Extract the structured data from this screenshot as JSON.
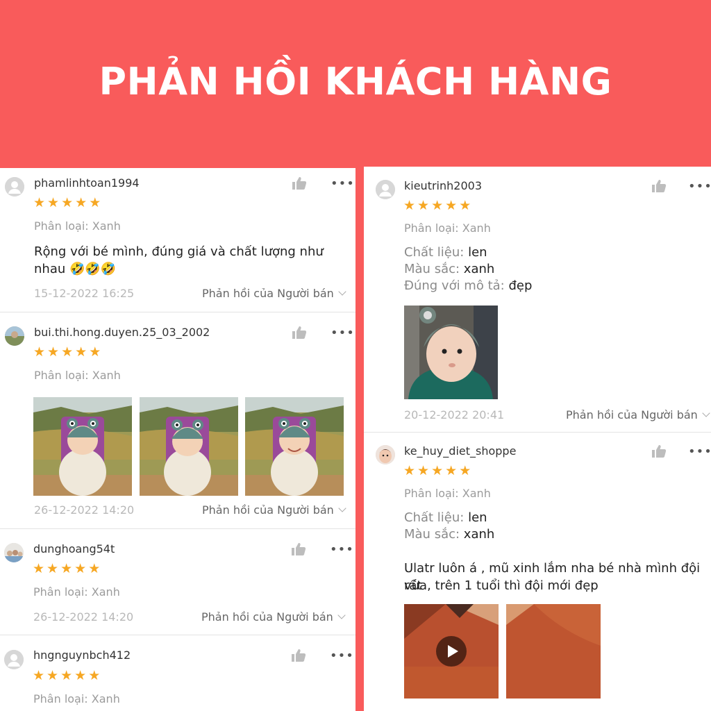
{
  "banner": {
    "title": "PHẢN HỒI KHÁCH HÀNG"
  },
  "reviews_left": [
    {
      "username": "phamlinhtoan1994",
      "rating": 5,
      "variant": "Phân loại: Xanh",
      "text_line1": "Rộng với bé mình, đúng giá và chất lượng như",
      "text_line2": "nhau 🤣🤣🤣",
      "date": "15-12-2022 16:25",
      "seller_reply": "Phản hồi của Người bán"
    },
    {
      "username": "bui.thi.hong.duyen.25_03_2002",
      "rating": 5,
      "variant": "Phân loại: Xanh",
      "date": "26-12-2022 14:20",
      "seller_reply": "Phản hồi của Người bán"
    },
    {
      "username": "dunghoang54t",
      "rating": 5,
      "variant": "Phân loại: Xanh",
      "date": "26-12-2022 14:20",
      "seller_reply": "Phản hồi của Người bán"
    },
    {
      "username": "hngnguynbch412",
      "rating": 5,
      "variant": "Phân loại: Xanh"
    }
  ],
  "reviews_right": [
    {
      "username": "kieutrinh2003",
      "rating": 5,
      "variant": "Phân loại: Xanh",
      "material_label": "Chất liệu:",
      "material_value": "len",
      "color_label": "Màu sắc:",
      "color_value": "xanh",
      "desc_label": "Đúng với mô tả:",
      "desc_value": "đẹp",
      "date": "20-12-2022 20:41",
      "seller_reply": "Phản hồi của Người bán"
    },
    {
      "username": "ke_huy_diet_shoppe",
      "rating": 5,
      "variant": "Phân loại: Xanh",
      "material_label": "Chất liệu:",
      "material_value": "len",
      "color_label": "Màu sắc:",
      "color_value": "xanh",
      "text_line1": "Ulatr luôn á , mũ xinh lắm nha bé nhà mình đội rất",
      "text_line2": "vừa, trên 1 tuổi thì đội mới đẹp"
    }
  ],
  "icons": {
    "like": "thumbs-up-icon",
    "more": "more-options-icon",
    "star": "star-icon",
    "play": "play-icon"
  },
  "colors": {
    "banner": "#f95b5b",
    "star": "#f6a723",
    "muted": "#9b9b9b"
  }
}
